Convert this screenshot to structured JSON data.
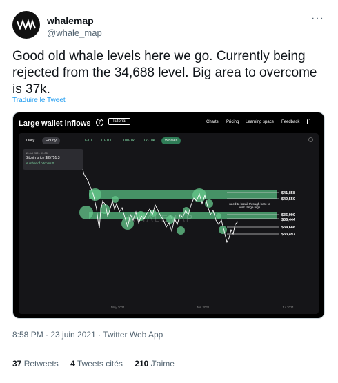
{
  "author": {
    "name": "whalemap",
    "handle": "@whale_map",
    "more_label": "···"
  },
  "tweet": {
    "text": "Good old whale levels here we go. Currently being rejected from the 34,688 level. Big area to overcome is 37k.",
    "translate_label": "Traduire le Tweet",
    "timestamp": "8:58 PM · 23 juin 2021 · Twitter Web App"
  },
  "media": {
    "title": "Large wallet inflows",
    "help_icon_glyph": "?",
    "tutorial_label": "Tutorial",
    "nav": [
      "Charts",
      "Pricing",
      "Learning space",
      "Feedback"
    ],
    "tabs": {
      "daily": "Daily",
      "hourly": "Hourly",
      "ranges": [
        "1-10",
        "10-100",
        "100-1k",
        "1k-10k",
        "Whales"
      ]
    },
    "tooltip": {
      "date": "15 Jul 2021 09:00",
      "price": "Bitcoin price $35751.3",
      "btc": "Number of bitcoins 0"
    },
    "watermark": "WHALEMAP",
    "annotation": [
      "need to break through here to",
      "visit range high"
    ],
    "levels": [
      "$41,858",
      "$40,550",
      "$36,990",
      "$36,444",
      "$34,688",
      "$33,497"
    ],
    "x_labels": [
      "May 2021",
      "Jun 2021",
      "Jul 2021"
    ]
  },
  "stats": {
    "retweets_count": "37",
    "retweets_label": "Retweets",
    "quotes_count": "4",
    "quotes_label": "Tweets cités",
    "likes_count": "210",
    "likes_label": "J'aime"
  },
  "colors": {
    "band": "#4fa874",
    "bubble": "#66c98c",
    "link": "#1d9bf0"
  }
}
